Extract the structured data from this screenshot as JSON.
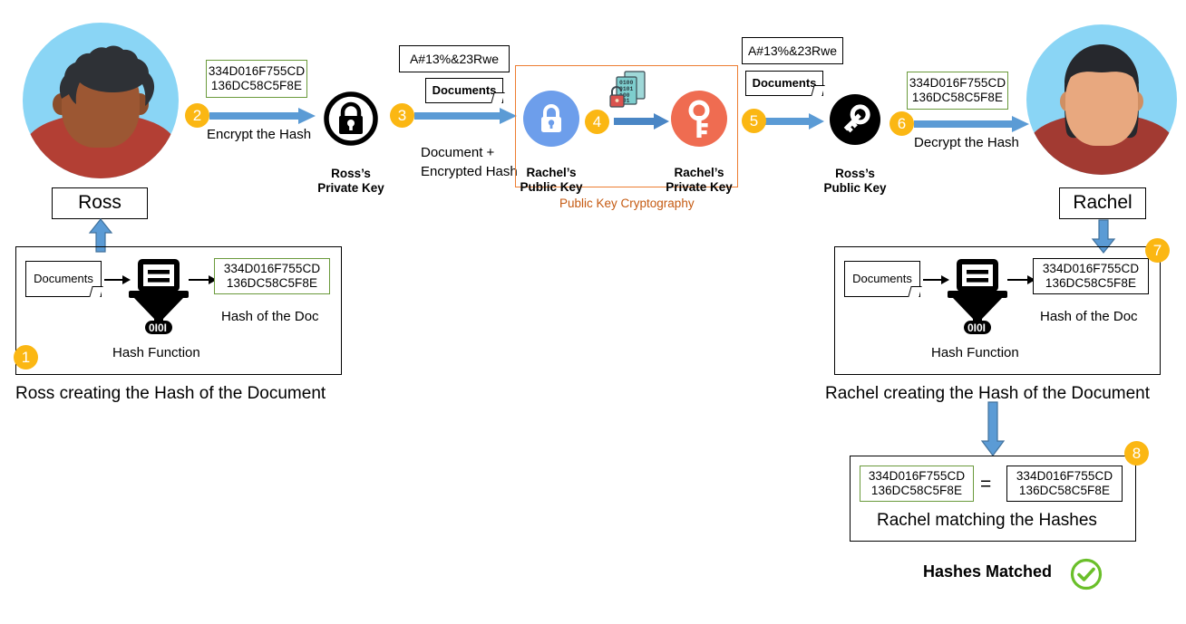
{
  "diagram": {
    "title_hidden": "",
    "hash_value": "334D016F755CD\n136DC58C5F8E",
    "encrypted_hash": "A#13%&23Rwe",
    "documents_label": "Documents"
  },
  "colors": {
    "badge": "#fbb713",
    "arrow_blue": "#5b9bd5",
    "arrow_blue_dark": "#41719c",
    "green_border": "#6a9a3b",
    "orange_border": "#ed7d31",
    "orange_text": "#c55a11",
    "check_green": "#6abf2a",
    "avatar_bg": "#8ad5f5",
    "ross_skin": "#9c5733",
    "ross_hair": "#2e3136",
    "ross_shirt": "#b33f34",
    "rachel_skin": "#e8a87f",
    "rachel_hair": "#26282d",
    "rachel_shirt": "#a23a32",
    "rachel_key_public": "#6d9eeb",
    "rachel_key_private": "#ef6c51"
  },
  "people": {
    "ross": {
      "name": "Ross"
    },
    "rachel": {
      "name": "Rachel"
    }
  },
  "steps": {
    "s1": "1",
    "s2": "2",
    "s3": "3",
    "s4": "4",
    "s5": "5",
    "s6": "6",
    "s7": "7",
    "s8": "8"
  },
  "ross_hash_panel": {
    "documents": "Documents",
    "hash": "334D016F755CD\n136DC58C5F8E",
    "hash_caption": "Hash of the Doc",
    "function_caption": "Hash Function",
    "panel_caption": "Ross creating the Hash of the Document"
  },
  "rachel_hash_panel": {
    "documents": "Documents",
    "hash": "334D016F755CD\n136DC58C5F8E",
    "hash_caption": "Hash of the Doc",
    "function_caption": "Hash Function",
    "panel_caption": "Rachel creating the Hash of the Document"
  },
  "step2": {
    "hash": "334D016F755CD\n136DC58C5F8E",
    "arrow_label": "Encrypt the Hash",
    "key_label": "Ross’s\nPrivate Key"
  },
  "step3": {
    "encrypted": "A#13%&23Rwe",
    "documents": "Documents",
    "arrow_label": "Document +\nEncrypted Hash"
  },
  "pkc": {
    "public_key_label": "Rachel’s\nPublic Key",
    "private_key_label": "Rachel’s\nPrivate Key",
    "caption": "Public Key Cryptography"
  },
  "step5": {
    "encrypted": "A#13%&23Rwe",
    "documents": "Documents",
    "key_label": "Ross’s\nPublic Key"
  },
  "step6": {
    "hash": "334D016F755CD\n136DC58C5F8E",
    "arrow_label": "Decrypt the Hash"
  },
  "match_panel": {
    "hash_left": "334D016F755CD\n136DC58C5F8E",
    "equals": "=",
    "hash_right": "334D016F755CD\n136DC58C5F8E",
    "caption": "Rachel matching the Hashes"
  },
  "result": {
    "text": "Hashes Matched",
    "icon": "check-circle-icon"
  }
}
